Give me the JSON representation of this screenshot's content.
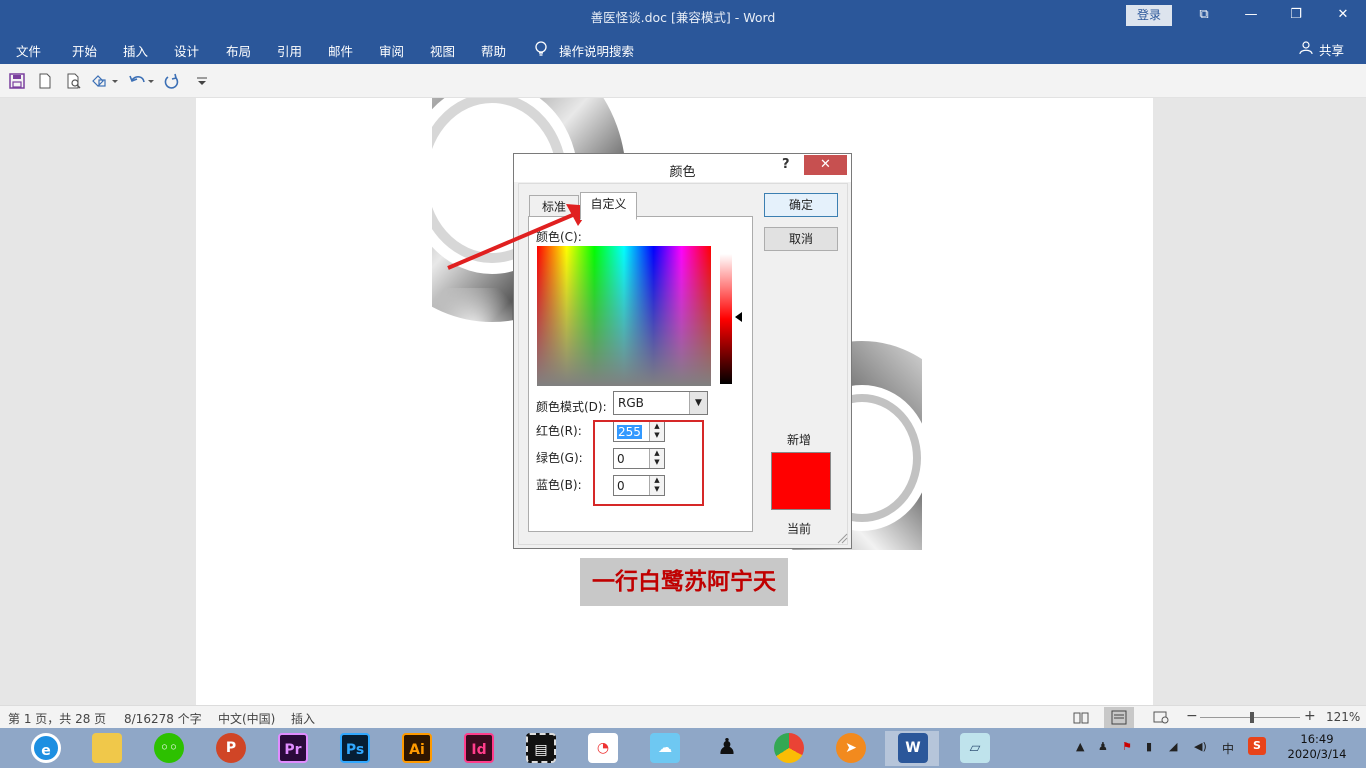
{
  "window": {
    "title": "善医怪谈.doc [兼容模式]  -  Word",
    "login_label": "登录",
    "controls": [
      "⧉",
      "—",
      "❐",
      "✕"
    ]
  },
  "ribbon": {
    "tabs": [
      "文件",
      "开始",
      "插入",
      "设计",
      "布局",
      "引用",
      "邮件",
      "审阅",
      "视图",
      "帮助"
    ],
    "tell_me": "操作说明搜索",
    "share": "共享"
  },
  "document": {
    "caption": "一行白鹭苏阿宁天"
  },
  "dialog": {
    "title": "颜色",
    "help": "?",
    "close": "✕",
    "tabs": [
      "标准",
      "自定义"
    ],
    "color_label": "颜色(C):",
    "mode_label": "颜色模式(D):",
    "mode_value": "RGB",
    "red_label": "红色(R):",
    "green_label": "绿色(G):",
    "blue_label": "蓝色(B):",
    "red_value": "255",
    "green_value": "0",
    "blue_value": "0",
    "ok": "确定",
    "cancel": "取消",
    "new_label": "新增",
    "current_label": "当前",
    "new_color": "#ff0000"
  },
  "status": {
    "page": "第 1 页，共 28 页",
    "words": "8/16278 个字",
    "language": "中文(中国)",
    "mode": "插入",
    "zoom": "121%"
  },
  "taskbar": {
    "apps": [
      "browser",
      "explorer",
      "wechat",
      "powerpoint",
      "premiere",
      "photoshop",
      "illustrator",
      "indesign",
      "video-editor",
      "app-store",
      "cloud",
      "qq",
      "chrome",
      "thunder",
      "word",
      "notepad"
    ],
    "ime": "中",
    "time": "16:49",
    "date": "2020/3/14"
  }
}
